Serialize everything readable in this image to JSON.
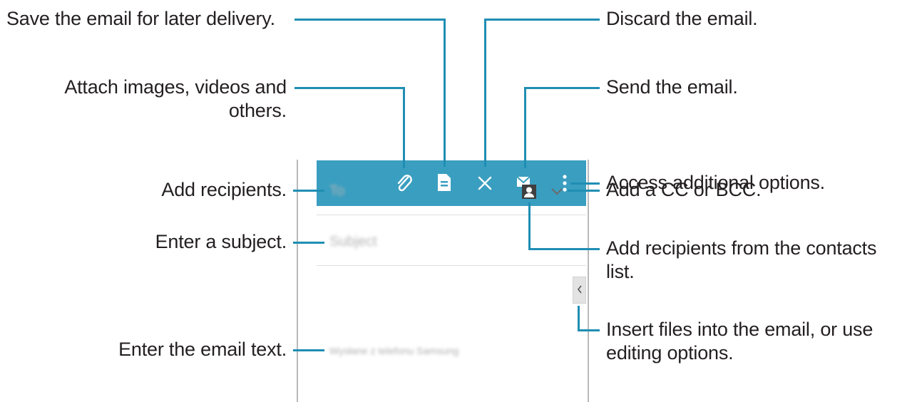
{
  "callouts": {
    "save": "Save the email for later delivery.",
    "discard": "Discard the email.",
    "attach_line1": "Attach images, videos and",
    "attach_line2": "others.",
    "send": "Send the email.",
    "more": "Access additional options.",
    "add_recipients": "Add recipients.",
    "cc_bcc": "Add a CC or BCC.",
    "subject": "Enter a subject.",
    "contacts_line1": "Add recipients from the contacts",
    "contacts_line2": "list.",
    "insert_line1": "Insert files into the email, or use",
    "insert_line2": "editing options.",
    "body": "Enter the email text."
  },
  "compose": {
    "to_placeholder": "To",
    "subject_placeholder": "Subject",
    "body_signature": "Wysłane z telefonu Samsung"
  },
  "toolbar_icons": [
    "paperclip-icon",
    "save-icon",
    "close-icon",
    "send-email-icon",
    "more-options-icon"
  ],
  "colors": {
    "accent": "#1f8eb3",
    "appbar": "#3a9ec0"
  }
}
